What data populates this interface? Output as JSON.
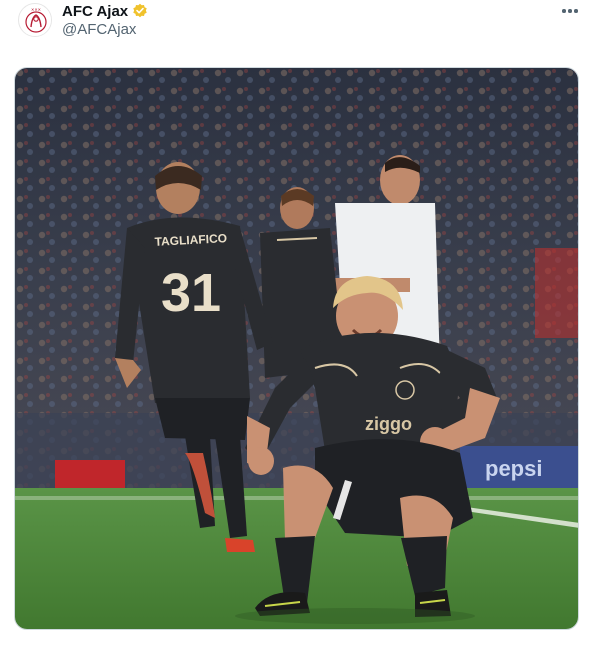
{
  "tweet": {
    "display_name": "AFC Ajax",
    "handle": "@AFCAjax",
    "verified_icon": "verified-badge-icon",
    "more_icon": "more-options-icon"
  },
  "photo": {
    "icon": "football-celebration-photo",
    "jersey_name": "TAGLIAFICO",
    "jersey_number": "31",
    "sponsor": "ziggo",
    "board_text": "pepsi"
  },
  "colors": {
    "verified": "#f0c22c",
    "pitch": "#4e8a3c",
    "ajax_kit": "#2a2c30"
  }
}
